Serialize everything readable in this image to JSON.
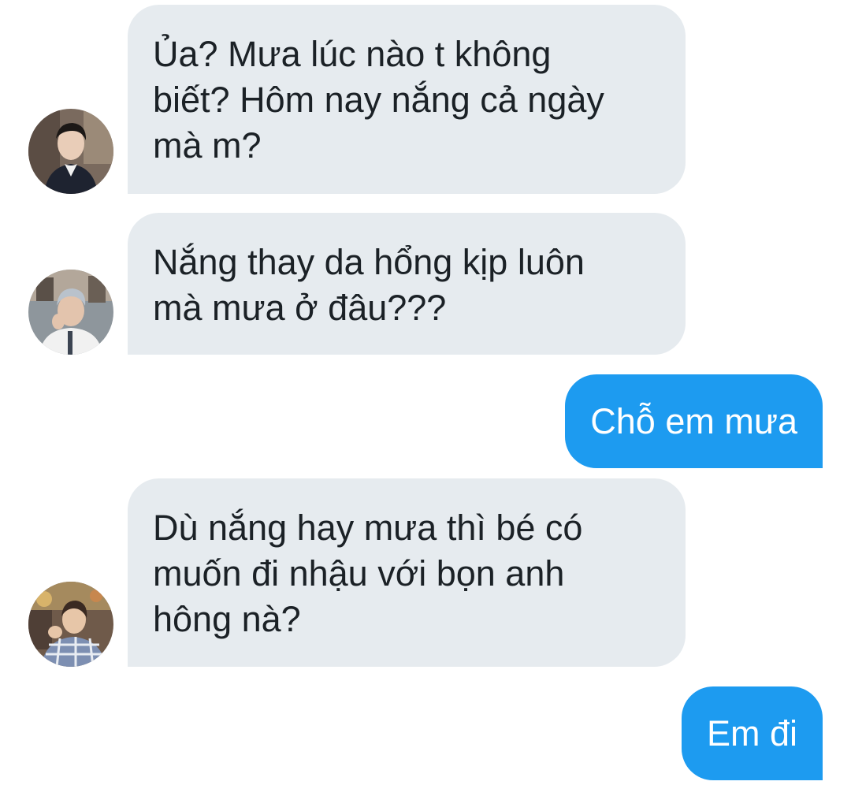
{
  "messages": [
    {
      "direction": "incoming",
      "sender_avatar": "avatar-person-dark-coat",
      "lines": [
        "Ủa? Mưa lúc nào t không",
        "biết? Hôm nay nắng cả ngày",
        "mà m?"
      ]
    },
    {
      "direction": "incoming",
      "sender_avatar": "avatar-person-white-shirt",
      "lines": [
        "Nắng thay da hổng kịp luôn",
        "mà mưa ở đâu???"
      ]
    },
    {
      "direction": "outgoing",
      "lines": [
        "Chỗ em mưa"
      ]
    },
    {
      "direction": "incoming",
      "sender_avatar": "avatar-person-plaid-shirt",
      "lines": [
        "Dù nắng hay mưa thì bé có",
        "muốn đi nhậu với bọn anh",
        "hông nà?"
      ]
    },
    {
      "direction": "outgoing",
      "lines": [
        "Em đi"
      ]
    }
  ],
  "colors": {
    "incoming_bubble": "#e6ebef",
    "incoming_text": "#1b2126",
    "outgoing_bubble": "#1d9bf0",
    "outgoing_text": "#ffffff",
    "background": "#ffffff"
  }
}
